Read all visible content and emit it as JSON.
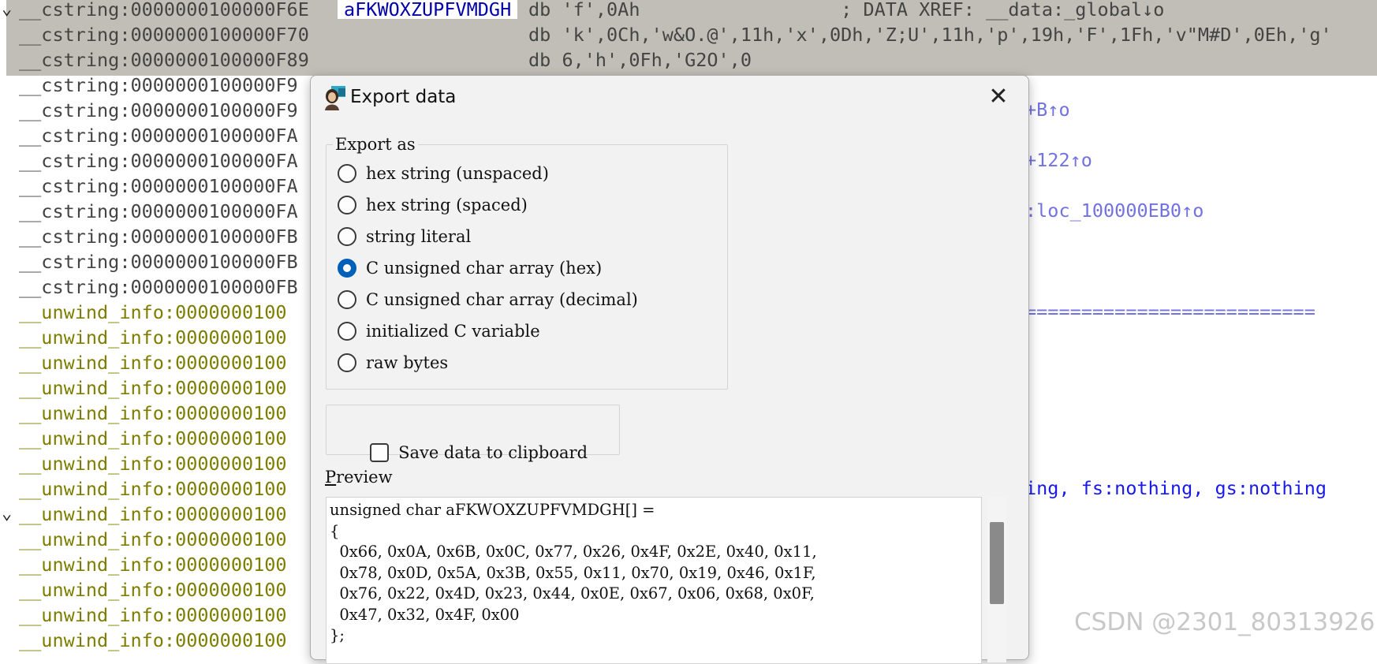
{
  "listing": {
    "rows": [
      {
        "arrow": "⌄",
        "seg": "c",
        "hl": true,
        "addr": "__cstring:0000000100000F6E",
        "label": "aFKWOXZUPFVMDGH",
        "ins": "db 'f',0Ah                  ; DATA XREF: __data:_global↓o"
      },
      {
        "arrow": "",
        "seg": "c",
        "hl": true,
        "addr": "__cstring:0000000100000F70",
        "label": "",
        "ins": "db 'k',0Ch,'w&O.@',11h,'x',0Dh,'Z;U',11h,'p',19h,'F',1Fh,'v\"M#D',0Eh,'g'"
      },
      {
        "arrow": "",
        "seg": "c",
        "hl": true,
        "addr": "__cstring:0000000100000F89",
        "label": "",
        "ins": "db 6,'h',0Fh,'G2O',0"
      },
      {
        "arrow": "",
        "seg": "c",
        "hl": false,
        "addr": "__cstring:0000000100000F9",
        "label": "",
        "ins": ""
      },
      {
        "arrow": "",
        "seg": "c",
        "hl": false,
        "addr": "__cstring:0000000100000F9",
        "label": "",
        "ins": ""
      },
      {
        "arrow": "",
        "seg": "c",
        "hl": false,
        "addr": "__cstring:0000000100000FA",
        "label": "",
        "ins": ""
      },
      {
        "arrow": "",
        "seg": "c",
        "hl": false,
        "addr": "__cstring:0000000100000FA",
        "label": "",
        "ins": ""
      },
      {
        "arrow": "",
        "seg": "c",
        "hl": false,
        "addr": "__cstring:0000000100000FA",
        "label": "",
        "ins": ""
      },
      {
        "arrow": "",
        "seg": "c",
        "hl": false,
        "addr": "__cstring:0000000100000FA",
        "label": "",
        "ins": ""
      },
      {
        "arrow": "",
        "seg": "c",
        "hl": false,
        "addr": "__cstring:0000000100000FB",
        "label": "",
        "ins": ""
      },
      {
        "arrow": "",
        "seg": "c",
        "hl": false,
        "addr": "__cstring:0000000100000FB",
        "label": "",
        "ins": ""
      },
      {
        "arrow": "",
        "seg": "c",
        "hl": false,
        "addr": "__cstring:0000000100000FB",
        "label": "",
        "ins": ""
      },
      {
        "arrow": "",
        "seg": "u",
        "hl": false,
        "addr": "__unwind_info:0000000100",
        "label": "",
        "ins": ""
      },
      {
        "arrow": "",
        "seg": "u",
        "hl": false,
        "addr": "__unwind_info:0000000100",
        "label": "",
        "ins": ""
      },
      {
        "arrow": "",
        "seg": "u",
        "hl": false,
        "addr": "__unwind_info:0000000100",
        "label": "",
        "ins": ""
      },
      {
        "arrow": "",
        "seg": "u",
        "hl": false,
        "addr": "__unwind_info:0000000100",
        "label": "",
        "ins": ""
      },
      {
        "arrow": "",
        "seg": "u",
        "hl": false,
        "addr": "__unwind_info:0000000100",
        "label": "",
        "ins": ""
      },
      {
        "arrow": "",
        "seg": "u",
        "hl": false,
        "addr": "__unwind_info:0000000100",
        "label": "",
        "ins": ""
      },
      {
        "arrow": "",
        "seg": "u",
        "hl": false,
        "addr": "__unwind_info:0000000100",
        "label": "",
        "ins": ""
      },
      {
        "arrow": "",
        "seg": "u",
        "hl": false,
        "addr": "__unwind_info:0000000100",
        "label": "",
        "ins": ""
      },
      {
        "arrow": "⌄",
        "seg": "u",
        "hl": false,
        "addr": "__unwind_info:0000000100",
        "label": "",
        "ins": ""
      },
      {
        "arrow": "",
        "seg": "u",
        "hl": false,
        "addr": "__unwind_info:0000000100",
        "label": "",
        "ins": ""
      },
      {
        "arrow": "",
        "seg": "u",
        "hl": false,
        "addr": "__unwind_info:0000000100",
        "label": "",
        "ins": ""
      },
      {
        "arrow": "",
        "seg": "u",
        "hl": false,
        "addr": "__unwind_info:0000000100",
        "label": "",
        "ins": ""
      },
      {
        "arrow": "",
        "seg": "u",
        "hl": false,
        "addr": "__unwind_info:0000000100",
        "label": "",
        "ins": ""
      },
      {
        "arrow": "",
        "seg": "u",
        "hl": false,
        "addr": "__unwind_info:0000000100",
        "label": "",
        "ins": ""
      }
    ],
    "right_fragments": {
      "xref_b": "+B↑o",
      "xref_122": "+122↑o",
      "xref_loc": ":loc_100000EB0↑o",
      "separator": "==========================",
      "assume": "ing, fs:nothing, gs:nothing"
    }
  },
  "dialog": {
    "title": "Export data",
    "close_glyph": "✕",
    "export_group_label": "Export as",
    "options": [
      {
        "label": "hex string (unspaced)",
        "selected": false
      },
      {
        "label": "hex string (spaced)",
        "selected": false
      },
      {
        "label": "string literal",
        "selected": false
      },
      {
        "label": "C unsigned char array (hex)",
        "selected": true
      },
      {
        "label": "C unsigned char array (decimal)",
        "selected": false
      },
      {
        "label": "initialized C variable",
        "selected": false
      },
      {
        "label": "raw bytes",
        "selected": false
      }
    ],
    "clipboard_label": "Save data to clipboard",
    "clipboard_checked": false,
    "preview_label_first": "P",
    "preview_label_rest": "review",
    "preview_text": "unsigned char aFKWOXZUPFVMDGH[] =\n{\n  0x66, 0x0A, 0x6B, 0x0C, 0x77, 0x26, 0x4F, 0x2E, 0x40, 0x11,\n  0x78, 0x0D, 0x5A, 0x3B, 0x55, 0x11, 0x70, 0x19, 0x46, 0x1F,\n  0x76, 0x22, 0x4D, 0x23, 0x44, 0x0E, 0x67, 0x06, 0x68, 0x0F,\n  0x47, 0x32, 0x4F, 0x00\n};"
  },
  "watermark": "CSDN @2301_80313926",
  "colors": {
    "segment_cstring": "#444444",
    "segment_unwind": "#7d7d00",
    "label_blue": "#0000a8",
    "xref_purple": "#7272e0",
    "highlight": "#c0beb6",
    "radio_selected": "#005fb8"
  }
}
